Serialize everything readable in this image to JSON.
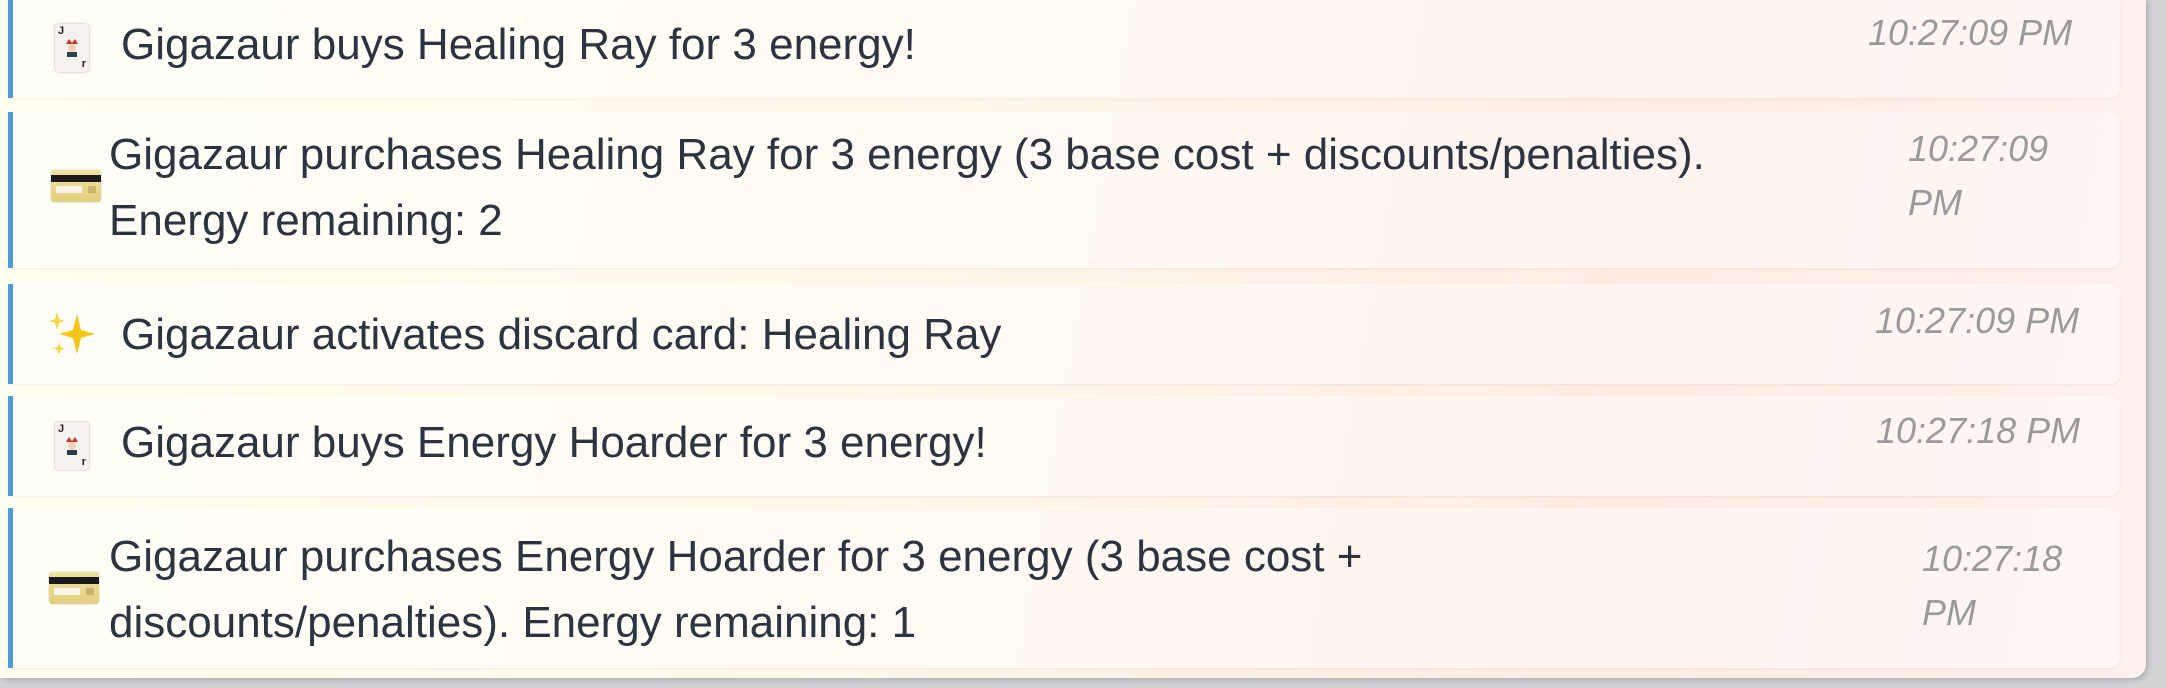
{
  "log": {
    "entries": [
      {
        "icon": "joker-card-icon",
        "lines": [
          "Gigazaur buys Healing Ray for 3 energy!"
        ],
        "time": [
          "10:27:09 PM"
        ]
      },
      {
        "icon": "credit-card-icon",
        "lines": [
          "Gigazaur purchases Healing Ray for 3 energy (3 base cost + discounts/penalties).",
          "Energy remaining: 2"
        ],
        "time": [
          "10:27:09",
          "PM"
        ]
      },
      {
        "icon": "sparkles-icon",
        "lines": [
          "Gigazaur activates discard card: Healing Ray"
        ],
        "time": [
          "10:27:09 PM"
        ]
      },
      {
        "icon": "joker-card-icon",
        "lines": [
          "Gigazaur buys Energy Hoarder for 3 energy!"
        ],
        "time": [
          "10:27:18 PM"
        ]
      },
      {
        "icon": "credit-card-icon",
        "lines": [
          "Gigazaur purchases Energy Hoarder for 3 energy (3 base cost +",
          "discounts/penalties). Energy remaining: 1"
        ],
        "time": [
          "10:27:18",
          "PM"
        ]
      }
    ]
  },
  "colors": {
    "accent_border": "#4a9bd6",
    "message_text": "#2b3440",
    "timestamp_text": "#9a9a9a",
    "sparkle": "#f5c518"
  }
}
